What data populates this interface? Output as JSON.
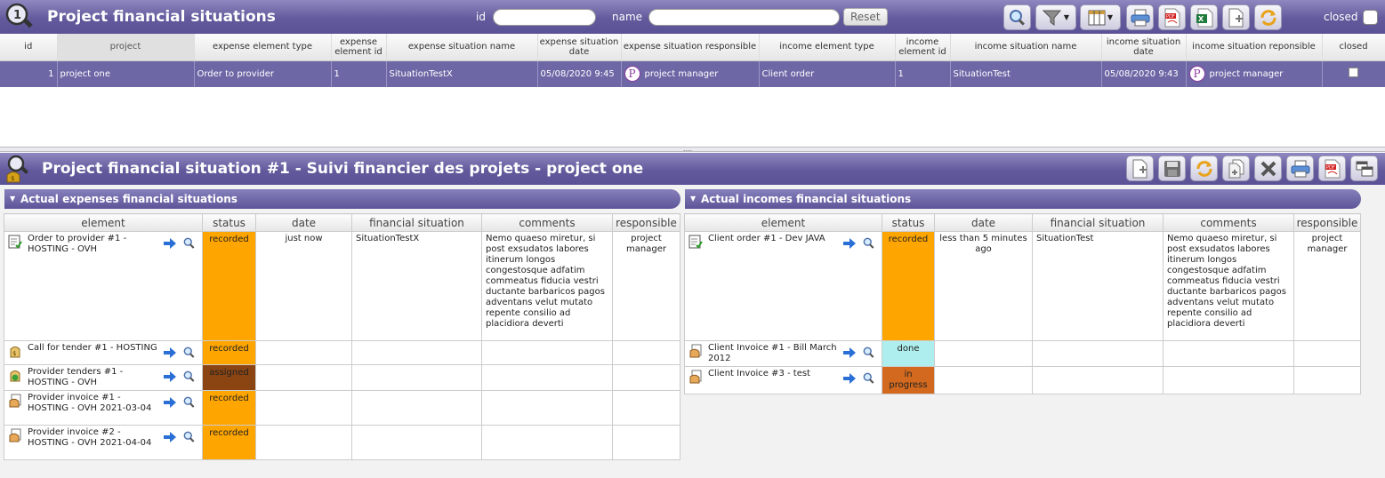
{
  "list": {
    "title": "Project financial situations",
    "filter_id_label": "id",
    "filter_name_label": "name",
    "reset_label": "Reset",
    "closed_label": "closed",
    "columns": [
      "id",
      "project",
      "expense element type",
      "expense element id",
      "expense situation name",
      "expense situation date",
      "expense situation responsible",
      "income element type",
      "income element id",
      "income situation name",
      "income situation date",
      "income situation reponsible",
      "closed"
    ],
    "rows": [
      {
        "id": "1",
        "project": "project one",
        "expense_element_type": "Order to provider",
        "expense_element_id": "1",
        "expense_situation_name": "SituationTestX",
        "expense_situation_date": "05/08/2020 9:45",
        "expense_responsible_initial": "P",
        "expense_responsible": "project manager",
        "income_element_type": "Client order",
        "income_element_id": "1",
        "income_situation_name": "SituationTest",
        "income_situation_date": "05/08/2020 9:43",
        "income_responsible_initial": "P",
        "income_responsible": "project manager"
      }
    ]
  },
  "detail": {
    "title": "Project financial situation  #1 - Suivi financier des projets - project one",
    "expenses": {
      "section_title": "Actual expenses financial situations",
      "columns": [
        "element",
        "status",
        "date",
        "financial situation",
        "comments",
        "responsible"
      ],
      "rows": [
        {
          "element": "Order to provider #1 - HOSTING - OVH",
          "status": "recorded",
          "date": "just now",
          "situation": "SituationTestX",
          "comments": "Nemo quaeso miretur, si post exsudatos labores itinerum longos congestosque adfatim commeatus fiducia vestri ductante barbaricos pagos adventans velut mutato repente consilio ad placidiora deverti",
          "responsible": "project manager"
        },
        {
          "element": "Call for tender #1 - HOSTING",
          "status": "recorded",
          "date": "",
          "situation": "",
          "comments": "",
          "responsible": ""
        },
        {
          "element": "Provider tenders #1 - HOSTING - OVH",
          "status": "assigned",
          "date": "",
          "situation": "",
          "comments": "",
          "responsible": ""
        },
        {
          "element": "Provider invoice #1 - HOSTING - OVH 2021-03-04",
          "status": "recorded",
          "date": "",
          "situation": "",
          "comments": "",
          "responsible": ""
        },
        {
          "element": "Provider invoice #2 - HOSTING - OVH 2021-04-04",
          "status": "recorded",
          "date": "",
          "situation": "",
          "comments": "",
          "responsible": ""
        }
      ]
    },
    "incomes": {
      "section_title": "Actual incomes financial situations",
      "columns": [
        "element",
        "status",
        "date",
        "financial situation",
        "comments",
        "responsible"
      ],
      "rows": [
        {
          "element": "Client order #1 - Dev JAVA",
          "status": "recorded",
          "date": "less than 5 minutes ago",
          "situation": "SituationTest",
          "comments": "Nemo quaeso miretur, si post exsudatos labores itinerum longos congestosque adfatim commeatus fiducia vestri ductante barbaricos pagos adventans velut mutato repente consilio ad placidiora deverti",
          "responsible": "project manager"
        },
        {
          "element": "Client Invoice #1 - Bill March 2012",
          "status": "done",
          "date": "",
          "situation": "",
          "comments": "",
          "responsible": ""
        },
        {
          "element": "Client Invoice #3 - test",
          "status": "in progress",
          "date": "",
          "situation": "",
          "comments": "",
          "responsible": ""
        }
      ]
    }
  },
  "colors": {
    "header_purple": "#625a9c",
    "selected_row": "#6d67a6",
    "status_recorded": "#ffa500",
    "status_assigned": "#8b4513",
    "status_done": "#aeeeee",
    "status_in_progress": "#d2691e"
  }
}
